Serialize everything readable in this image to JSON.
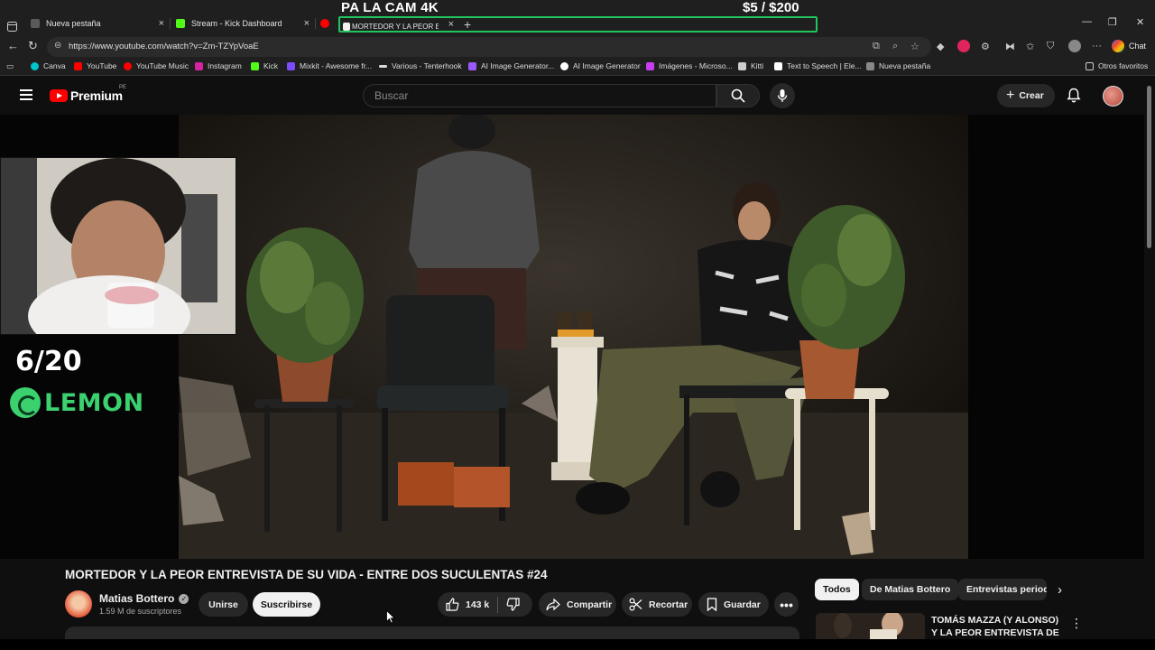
{
  "overlay": {
    "title": "PA LA CAM 4K",
    "goal": "$5  / $200",
    "counter": "6/20",
    "sponsor": "LEMON"
  },
  "browser": {
    "tabs": [
      {
        "label": "Nueva pestaña",
        "color": "#5a5a5a"
      },
      {
        "label": "Stream - Kick Dashboard",
        "color": "#53fc18"
      },
      {
        "label": "MORTEDOR Y LA PEOR ENTR",
        "color": "#ff0000"
      }
    ],
    "url": "https://www.youtube.com/watch?v=Zm-TZYpVoaE",
    "chat_label": "Chat",
    "bookmarks": [
      {
        "label": "Canva",
        "color": "#00c4cc"
      },
      {
        "label": "YouTube",
        "color": "#ff0000"
      },
      {
        "label": "YouTube Music",
        "color": "#ff0000"
      },
      {
        "label": "Instagram",
        "color": "#d6249f"
      },
      {
        "label": "Kick",
        "color": "#53fc18"
      },
      {
        "label": "Mixkit - Awesome fr...",
        "color": "#7b4dff"
      },
      {
        "label": "Various - Tenterhook",
        "color": "#dddddd"
      },
      {
        "label": "AI Image Generator...",
        "color": "#9b59ff"
      },
      {
        "label": "AI Image Generator",
        "color": "#ffffff"
      },
      {
        "label": "Imágenes - Microso...",
        "color": "#c73ef2"
      },
      {
        "label": "Kitti",
        "color": "#cccccc"
      },
      {
        "label": "Text to Speech | Ele...",
        "color": "#ffffff"
      },
      {
        "label": "Nueva pestaña",
        "color": "#888888"
      }
    ],
    "other_bookmarks": "Otros favoritos"
  },
  "youtube": {
    "logo_text": "Premium",
    "country_code": "PE",
    "search_placeholder": "Buscar",
    "create_label": "Crear",
    "video": {
      "title": "MORTEDOR Y LA PEOR ENTREVISTA DE SU VIDA - ENTRE DOS SUCULENTAS #24",
      "channel": "Matias Bottero",
      "subscribers": "1.59 M de suscriptores",
      "join_label": "Unirse",
      "subscribe_label": "Suscribirse",
      "likes": "143 k",
      "share_label": "Compartir",
      "clip_label": "Recortar",
      "save_label": "Guardar"
    },
    "chips": [
      "Todos",
      "De Matias Bottero",
      "Entrevistas periodí"
    ],
    "recommendation": {
      "title": "TOMÁS MAZZA (Y ALONSO) Y LA PEOR ENTREVISTA DE SU"
    }
  }
}
